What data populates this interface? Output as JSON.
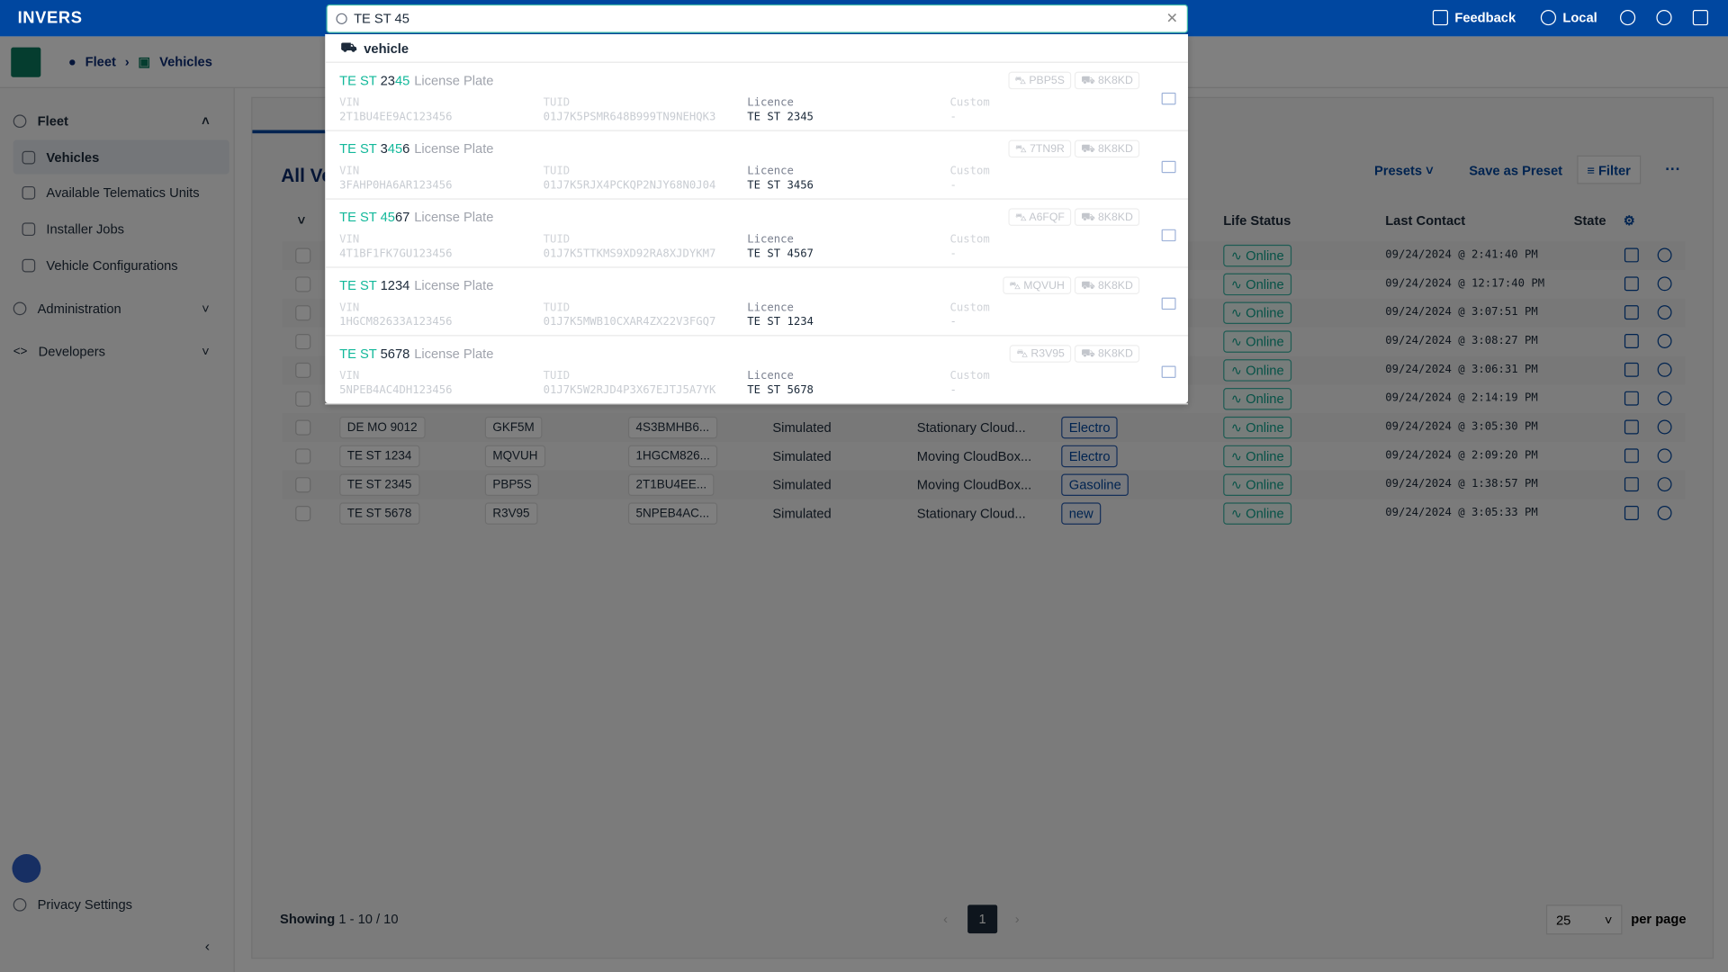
{
  "topbar": {
    "logo": "INVERS",
    "search_value": "TE ST 45",
    "feedback": "Feedback",
    "locale": "Local",
    "brand_color": "#0047a0"
  },
  "breadcrumb": {
    "fleet": "Fleet",
    "vehicles": "Vehicles"
  },
  "sidebar": {
    "fleet": "Fleet",
    "items": [
      "Vehicles",
      "Available Telematics Units",
      "Installer Jobs",
      "Vehicle Configurations"
    ],
    "administration": "Administration",
    "developers": "Developers",
    "privacy": "Privacy Settings"
  },
  "main": {
    "title": "All Ve",
    "presets": "Presets",
    "save_preset": "Save as Preset",
    "filter": "Filter"
  },
  "table": {
    "headers": {
      "life_status": "Life Status",
      "last_contact": "Last Contact",
      "state": "State"
    },
    "rows": [
      {
        "plate": "",
        "tuid": "",
        "vin": "",
        "source": "",
        "type": "",
        "tag": "",
        "status": "Online",
        "last": "09/24/2024 @ 2:41:40 PM"
      },
      {
        "plate": "",
        "tuid": "",
        "vin": "",
        "source": "",
        "type": "",
        "tag": "",
        "status": "Online",
        "last": "09/24/2024 @ 12:17:40 PM"
      },
      {
        "plate": "",
        "tuid": "",
        "vin": "",
        "source": "",
        "type": "",
        "tag": "",
        "status": "Online",
        "last": "09/24/2024 @ 3:07:51 PM"
      },
      {
        "plate": "",
        "tuid": "",
        "vin": "",
        "source": "",
        "type": "",
        "tag": "",
        "status": "Online",
        "last": "09/24/2024 @ 3:08:27 PM"
      },
      {
        "plate": "",
        "tuid": "",
        "vin": "",
        "source": "",
        "type": "",
        "tag": "",
        "status": "Online",
        "last": "09/24/2024 @ 3:06:31 PM"
      },
      {
        "plate": "",
        "tuid": "",
        "vin": "",
        "source": "",
        "type": "",
        "tag": "",
        "status": "Online",
        "last": "09/24/2024 @ 2:14:19 PM"
      },
      {
        "plate": "DE MO 9012",
        "tuid": "GKF5M",
        "vin": "4S3BMHB6...",
        "source": "Simulated",
        "type": "Stationary Cloud...",
        "tag": "Electro",
        "status": "Online",
        "last": "09/24/2024 @ 3:05:30 PM"
      },
      {
        "plate": "TE ST 1234",
        "tuid": "MQVUH",
        "vin": "1HGCM826...",
        "source": "Simulated",
        "type": "Moving CloudBox...",
        "tag": "Electro",
        "status": "Online",
        "last": "09/24/2024 @ 2:09:20 PM"
      },
      {
        "plate": "TE ST 2345",
        "tuid": "PBP5S",
        "vin": "2T1BU4EE...",
        "source": "Simulated",
        "type": "Moving CloudBox...",
        "tag": "Gasoline",
        "status": "Online",
        "last": "09/24/2024 @ 1:38:57 PM"
      },
      {
        "plate": "TE ST 5678",
        "tuid": "R3V95",
        "vin": "5NPEB4AC...",
        "source": "Simulated",
        "type": "Stationary Cloud...",
        "tag": "new",
        "status": "Online",
        "last": "09/24/2024 @ 3:05:33 PM"
      }
    ]
  },
  "footer": {
    "showing": "Showing",
    "range": "1 - 10 / 10",
    "page": "1",
    "per_page_value": "25",
    "per_page": "per page"
  },
  "dropdown": {
    "group": "vehicle",
    "type_label": "License Plate",
    "labels": {
      "vin": "VIN",
      "tuid": "TUID",
      "licence": "Licence",
      "custom": "Custom"
    },
    "items": [
      {
        "segments": [
          [
            "TE ST ",
            1
          ],
          [
            "23",
            0
          ],
          [
            "45",
            1
          ]
        ],
        "car": "PBP5S",
        "tu": "8K8KD",
        "vin": "2T1BU4EE9AC123456",
        "tuid": "01J7K5PSMR648B999TN9NEHQK3",
        "licence": "TE ST 2345",
        "custom": "-"
      },
      {
        "segments": [
          [
            "TE ST ",
            1
          ],
          [
            "3",
            0
          ],
          [
            "45",
            1
          ],
          [
            "6",
            0
          ]
        ],
        "car": "7TN9R",
        "tu": "8K8KD",
        "vin": "3FAHP0HA6AR123456",
        "tuid": "01J7K5RJX4PCKQP2NJY68N0J04",
        "licence": "TE ST 3456",
        "custom": "-"
      },
      {
        "segments": [
          [
            "TE ST ",
            1
          ],
          [
            "45",
            1
          ],
          [
            "67",
            0
          ]
        ],
        "car": "A6FQF",
        "tu": "8K8KD",
        "vin": "4T1BF1FK7GU123456",
        "tuid": "01J7K5TTKMS9XD92RA8XJDYKM7",
        "licence": "TE ST 4567",
        "custom": "-"
      },
      {
        "segments": [
          [
            "TE ST ",
            1
          ],
          [
            "1234",
            0
          ]
        ],
        "car": "MQVUH",
        "tu": "8K8KD",
        "vin": "1HGCM82633A123456",
        "tuid": "01J7K5MWB10CXAR4ZX22V3FGQ7",
        "licence": "TE ST 1234",
        "custom": "-"
      },
      {
        "segments": [
          [
            "TE ST ",
            1
          ],
          [
            "5678",
            0
          ]
        ],
        "car": "R3V95",
        "tu": "8K8KD",
        "vin": "5NPEB4AC4DH123456",
        "tuid": "01J7K5W2RJD4P3X67EJTJ5A7YK",
        "licence": "TE ST 5678",
        "custom": "-"
      }
    ]
  }
}
